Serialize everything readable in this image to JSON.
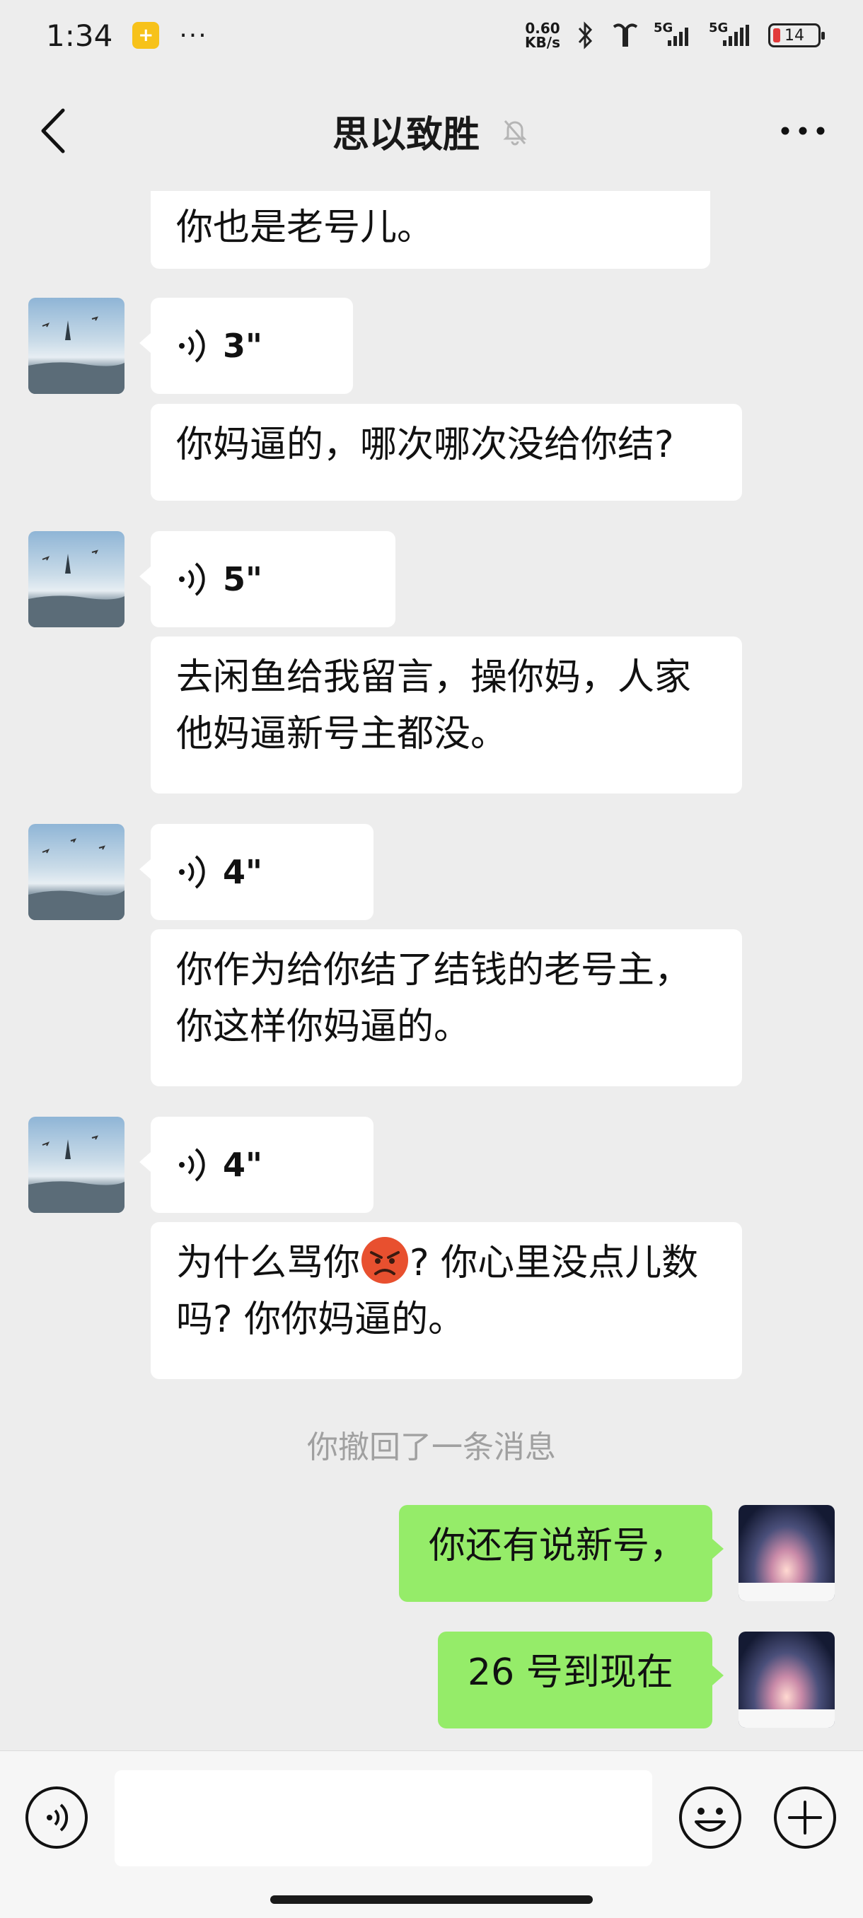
{
  "status_bar": {
    "time": "1:34",
    "dots": "···",
    "net_speed_value": "0.60",
    "net_speed_unit": "KB/s",
    "sim1_label": "5G",
    "sim2_label": "5G",
    "battery": "14"
  },
  "header": {
    "title": "思以致胜"
  },
  "messages": {
    "m0": "你也是老号儿。",
    "v1": "3\"",
    "m1": "你妈逼的，哪次哪次没给你结?",
    "v2": "5\"",
    "m2": "去闲鱼给我留言，操你妈，人家他妈逼新号主都没。",
    "v3": "4\"",
    "m3": "你作为给你结了结钱的老号主，你这样你妈逼的。",
    "v4": "4\"",
    "m4_before": "为什么骂你",
    "m4_after": "? 你心里没点儿数吗? 你你妈逼的。",
    "system": "你撤回了一条消息",
    "out1": "你还有说新号，",
    "out2": "26 号到现在"
  },
  "input": {
    "placeholder": ""
  },
  "icons": {
    "back": "chevron-left-icon",
    "mute": "bell-slash-icon",
    "more": "more-dots-icon",
    "voice": "voice-wave-icon",
    "emoji": "smile-icon",
    "add": "plus-icon",
    "angry": "angry-face-emoji"
  },
  "colors": {
    "background": "#ededed",
    "incoming_bubble": "#ffffff",
    "outgoing_bubble": "#95ec69",
    "system_text": "#a0a0a0"
  }
}
